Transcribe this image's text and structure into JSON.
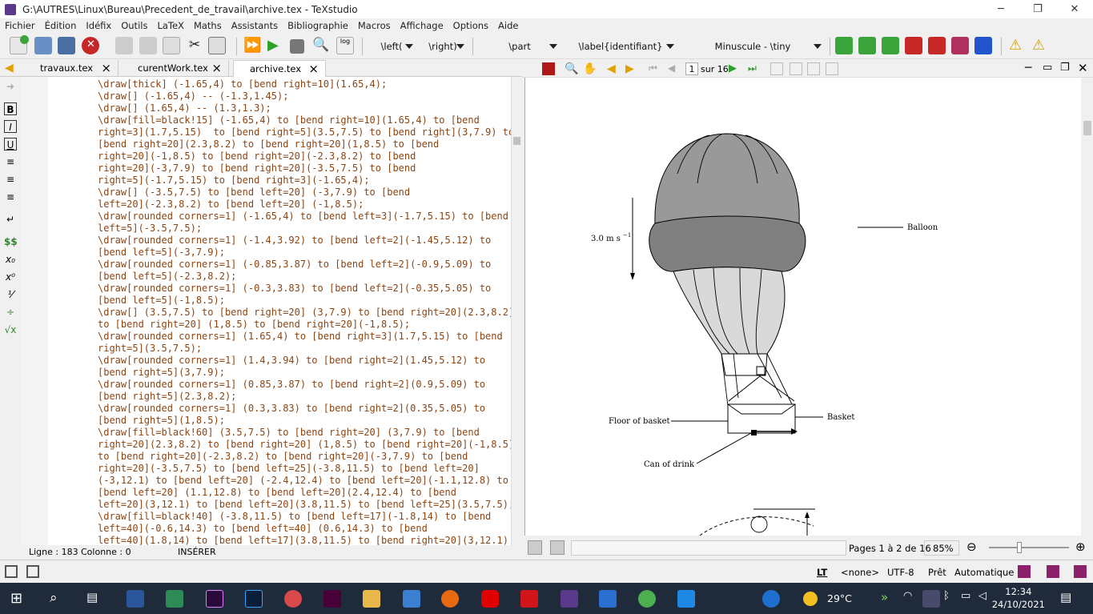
{
  "window": {
    "title": "G:\\AUTRES\\Linux\\Bureau\\Precedent_de_travail\\archive.tex - TeXstudio"
  },
  "menu": [
    "Fichier",
    "Édition",
    "Idéfix",
    "Outils",
    "LaTeX",
    "Maths",
    "Assistants",
    "Bibliographie",
    "Macros",
    "Affichage",
    "Options",
    "Aide"
  ],
  "toolbar": {
    "left_combo": "\\left(",
    "right_combo": "\\right)",
    "part_combo": "\\part",
    "label_combo": "\\label{identifiant}",
    "size_combo": "Minuscule - \\tiny"
  },
  "tabs": [
    {
      "label": "travaux.tex"
    },
    {
      "label": "curentWork.tex"
    },
    {
      "label": "archive.tex"
    }
  ],
  "editor": {
    "lines": [
      "\\draw[thick] (-1.65,4) to [bend right=10](1.65,4);",
      "\\draw[] (-1.65,4) -- (-1.3,1.45);",
      "\\draw[] (1.65,4) -- (1.3,1.3);",
      "\\draw[fill=black!15] (-1.65,4) to [bend right=10](1.65,4) to [bend",
      "right=3](1.7,5.15)  to [bend right=5](3.5,7.5) to [bend right](3,7.9) to",
      "[bend right=20](2.3,8.2) to [bend right=20](1,8.5) to [bend",
      "right=20](-1,8.5) to [bend right=20](-2.3,8.2) to [bend",
      "right=20](-3,7.9) to [bend right=20](-3.5,7.5) to [bend",
      "right=5](-1.7,5.15) to [bend right=3](-1.65,4);",
      "\\draw[] (-3.5,7.5) to [bend left=20] (-3,7.9) to [bend",
      "left=20](-2.3,8.2) to [bend left=20] (-1,8.5);",
      "\\draw[rounded corners=1] (-1.65,4) to [bend left=3](-1.7,5.15) to [bend",
      "left=5](-3.5,7.5);",
      "\\draw[rounded corners=1] (-1.4,3.92) to [bend left=2](-1.45,5.12) to",
      "[bend left=5](-3,7.9);",
      "\\draw[rounded corners=1] (-0.85,3.87) to [bend left=2](-0.9,5.09) to",
      "[bend left=5](-2.3,8.2);",
      "\\draw[rounded corners=1] (-0.3,3.83) to [bend left=2](-0.35,5.05) to",
      "[bend left=5](-1,8.5);",
      "\\draw[] (3.5,7.5) to [bend right=20] (3,7.9) to [bend right=20](2.3,8.2)",
      "to [bend right=20] (1,8.5) to [bend right=20](-1,8.5);",
      "\\draw[rounded corners=1] (1.65,4) to [bend right=3](1.7,5.15) to [bend",
      "right=5](3.5,7.5);",
      "\\draw[rounded corners=1] (1.4,3.94) to [bend right=2](1.45,5.12) to",
      "[bend right=5](3,7.9);",
      "\\draw[rounded corners=1] (0.85,3.87) to [bend right=2](0.9,5.09) to",
      "[bend right=5](2.3,8.2);",
      "\\draw[rounded corners=1] (0.3,3.83) to [bend right=2](0.35,5.05) to",
      "[bend right=5](1,8.5);",
      "\\draw[fill=black!60] (3.5,7.5) to [bend right=20] (3,7.9) to [bend",
      "right=20](2.3,8.2) to [bend right=20] (1,8.5) to [bend right=20](-1,8.5)",
      "to [bend right=20](-2.3,8.2) to [bend right=20](-3,7.9) to [bend",
      "right=20](-3.5,7.5) to [bend left=25](-3.8,11.5) to [bend left=20]",
      "(-3,12.1) to [bend left=20] (-2.4,12.4) to [bend left=20](-1.1,12.8) to",
      "[bend left=20] (1.1,12.8) to [bend left=20](2.4,12.4) to [bend",
      "left=20](3,12.1) to [bend left=20](3.8,11.5) to [bend left=25](3.5,7.5);",
      "\\draw[fill=black!40] (-3.8,11.5) to [bend left=17](-1.8,14) to [bend",
      "left=40](-0.6,14.3) to [bend left=40] (0.6,14.3) to [bend",
      "left=40](1.8,14) to [bend left=17](3.8,11.5) to [bend right=20](3,12.1)"
    ]
  },
  "status": {
    "line": "Ligne : 183",
    "column": "Colonne : 0",
    "mode": "INSÉRER"
  },
  "pdf": {
    "page_input": "1",
    "page_total": "sur 16",
    "pages_info": "Pages 1 à 2 de 16",
    "zoom": "85%",
    "labels": {
      "velocity": "3.0 m s",
      "velocity_exp": "−1",
      "balloon": "Balloon",
      "basket": "Basket",
      "floor": "Floor of basket",
      "can": "Can of drink"
    }
  },
  "bottom_status": {
    "lt": "LT",
    "none": "<none>",
    "encoding": "UTF-8",
    "ready": "Prêt",
    "auto": "Automatique"
  },
  "taskbar": {
    "temperature": "29°C",
    "time": "12:34",
    "date": "24/10/2021"
  },
  "colors": {
    "code": "#8b4513",
    "taskbar": "#1f2a3a",
    "balloon_dark": "#808080",
    "balloon_mid": "#999999",
    "balloon_light": "#d9d9d9"
  }
}
